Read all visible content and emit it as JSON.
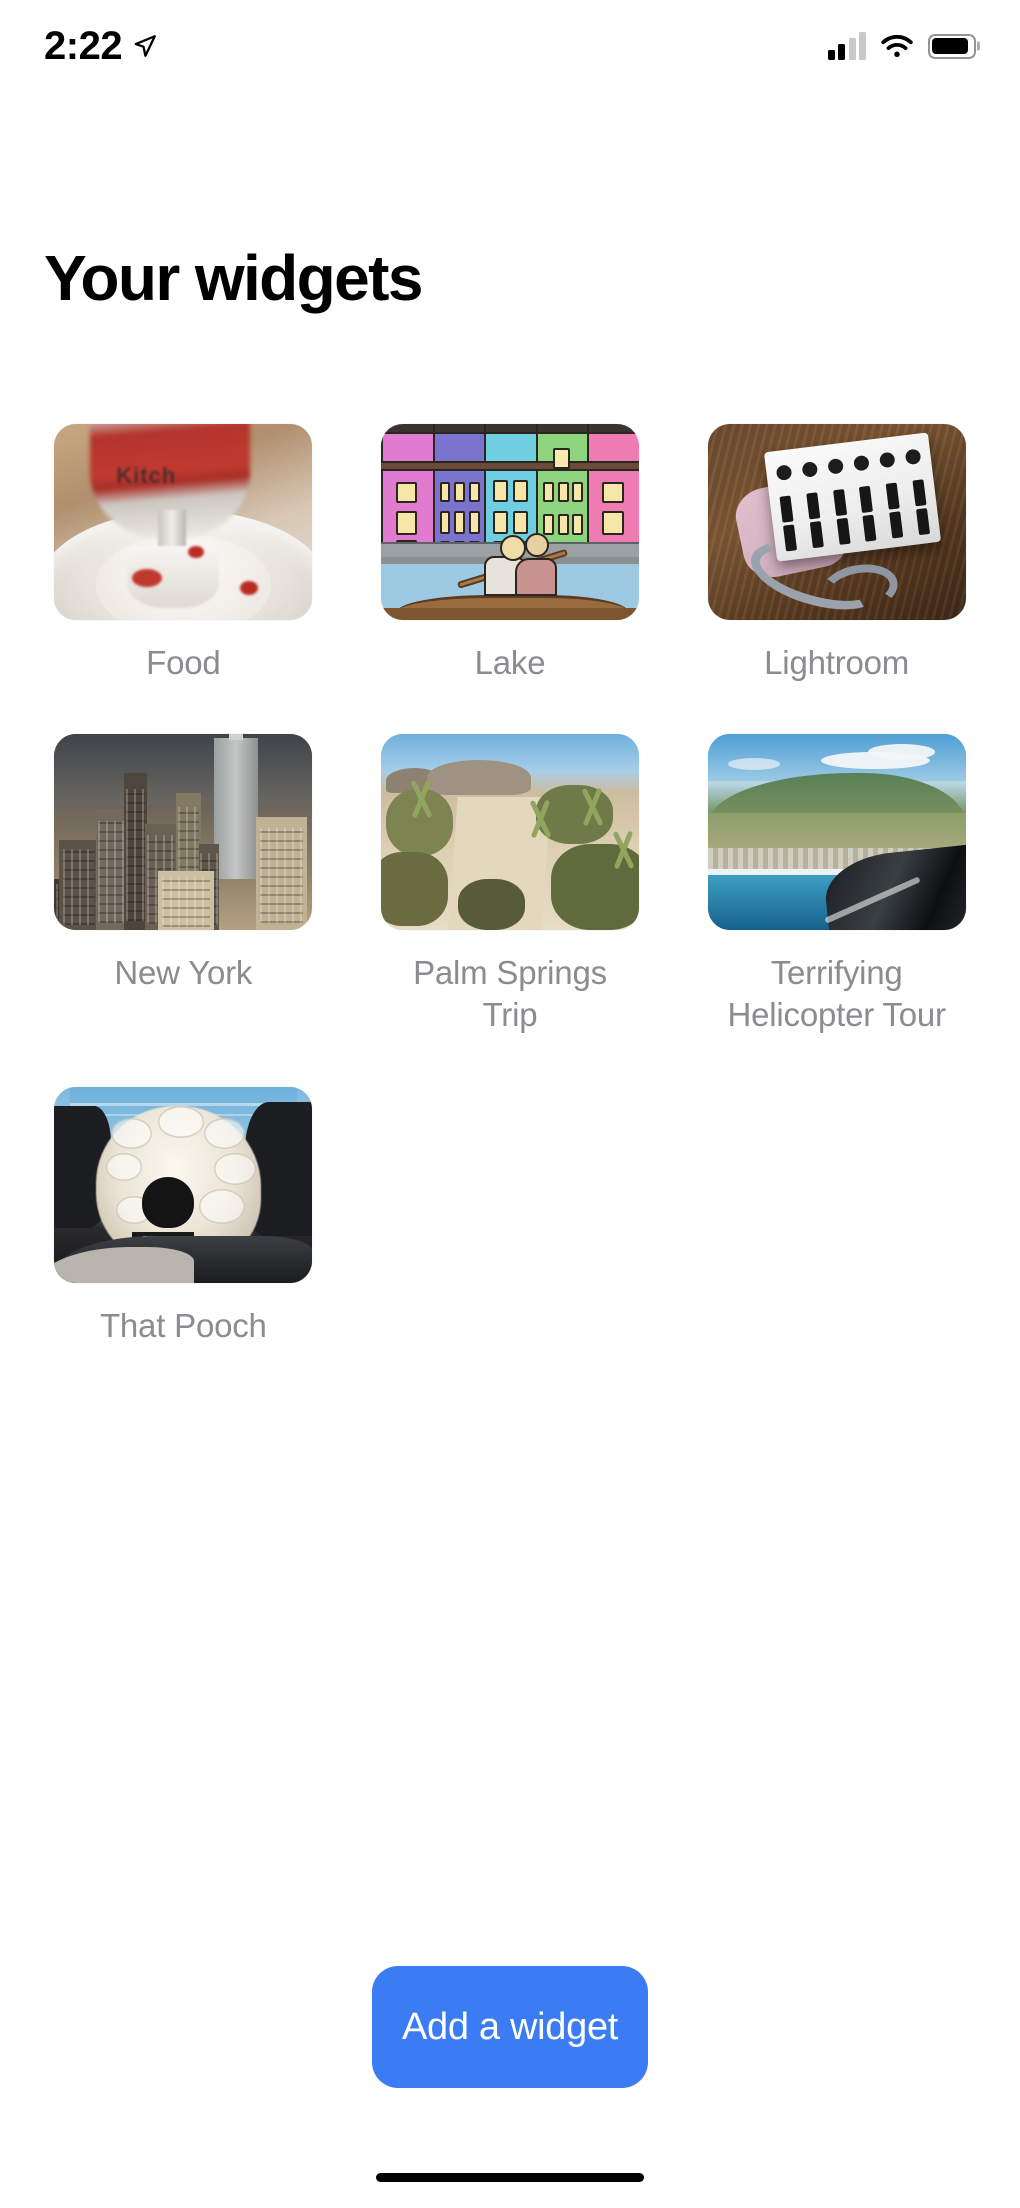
{
  "status_bar": {
    "time": "2:22",
    "location_icon": "location-arrow-icon",
    "signal_icon": "cellular-signal-icon",
    "wifi_icon": "wifi-icon",
    "battery_icon": "battery-icon"
  },
  "header": {
    "title": "Your widgets"
  },
  "widgets": [
    {
      "label": "Food",
      "art": "food"
    },
    {
      "label": "Lake",
      "art": "lake"
    },
    {
      "label": "Lightroom",
      "art": "lightroom"
    },
    {
      "label": "New York",
      "art": "newyork"
    },
    {
      "label": "Palm Springs Trip",
      "art": "palmsprings"
    },
    {
      "label": "Terrifying Helicopter Tour",
      "art": "helicopter"
    },
    {
      "label": "That Pooch",
      "art": "pooch"
    }
  ],
  "footer": {
    "add_button_label": "Add a widget"
  },
  "colors": {
    "accent_blue": "#3b7bf3",
    "label_gray": "#8b8b90",
    "background": "#ffffff",
    "title_black": "#000000"
  }
}
